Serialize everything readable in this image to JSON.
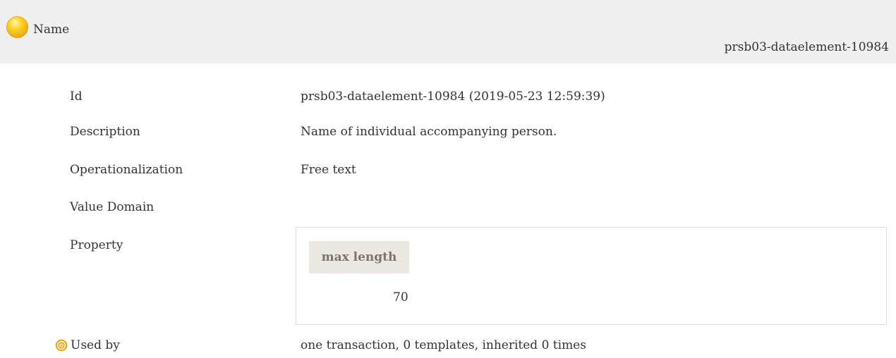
{
  "header": {
    "title": "Name",
    "id": "prsb03-dataelement-10984",
    "icon": "yellow-ball-icon"
  },
  "rows": {
    "id": {
      "label": "Id",
      "value": "prsb03-dataelement-10984 (2019-05-23 12:59:39)"
    },
    "description": {
      "label": "Description",
      "value": "Name of individual accompanying person."
    },
    "operationalization": {
      "label": "Operationalization",
      "value": "Free text"
    },
    "value_domain": {
      "label": "Value Domain"
    },
    "property": {
      "label": "Property",
      "column_header": "max length",
      "value": "70"
    },
    "used_by": {
      "label": "Used by",
      "value": "one transaction, 0 templates, inherited 0 times",
      "icon": "target-icon"
    }
  },
  "colors": {
    "header_bg": "#efefef",
    "property_header_bg": "#ebe7e1",
    "property_header_text": "#7d7368",
    "ball_yellow": "#ffc800",
    "target_orange": "#f5a000"
  }
}
